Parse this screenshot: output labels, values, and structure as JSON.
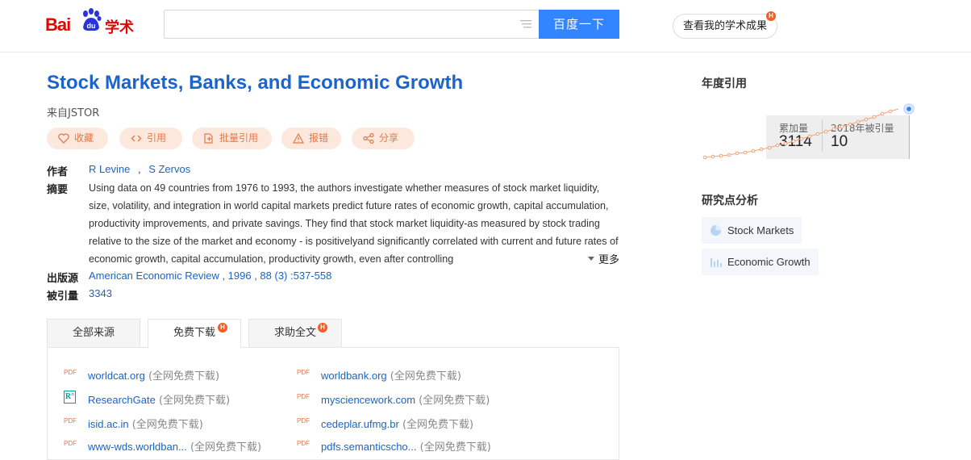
{
  "header": {
    "logo": "Baidu学术",
    "search_placeholder": "",
    "search_button": "百度一下",
    "my_achievements": "查看我的学术成果",
    "badge": "H"
  },
  "paper": {
    "title": "Stock Markets, Banks, and Economic Growth",
    "source": "来自JSTOR",
    "actions": [
      "收藏",
      "引用",
      "批量引用",
      "报错",
      "分享"
    ],
    "authors_label": "作者",
    "authors": [
      "R Levine",
      "S Zervos"
    ],
    "author_separator": ",",
    "abstract_label": "摘要",
    "abstract": "Using data on 49 countries from 1976 to 1993, the authors investigate whether measures of stock market liquidity, size, volatility, and integration in world capital markets predict future rates of economic growth, capital accumulation, productivity improvements, and private savings. They find that stock market liquidity-as measured by stock trading relative to the size of the market and economy - is positivelyand significantly correlated with current and future rates of economic growth, capital accumulation, productivity growth, even after controlling",
    "more": "更多",
    "publication_label": "出版源",
    "publication": "American Economic Review , 1996 , 88 (3) :537-558",
    "cited_label": "被引量",
    "cited_count": "3343"
  },
  "tabs": [
    {
      "label": "全部来源",
      "badge": ""
    },
    {
      "label": "免费下载",
      "badge": "H",
      "active": true
    },
    {
      "label": "求助全文",
      "badge": "H"
    }
  ],
  "downloads": {
    "note": "(全网免费下载)",
    "left": [
      {
        "site": "worldcat.org",
        "icon": "pdf-icon"
      },
      {
        "site": "ResearchGate",
        "icon": "researchgate-icon"
      },
      {
        "site": "isid.ac.in",
        "icon": "pdf-icon"
      },
      {
        "site": "www-wds.worldban...",
        "icon": "pdf-icon"
      }
    ],
    "right": [
      {
        "site": "worldbank.org",
        "icon": "pdf-icon"
      },
      {
        "site": "mysciencework.com",
        "icon": "pdf-icon"
      },
      {
        "site": "cedeplar.ufmg.br",
        "icon": "pdf-icon"
      },
      {
        "site": "pdfs.semanticscho...",
        "icon": "pdf-icon"
      }
    ],
    "pdf_label": "PDF",
    "rg_label": "R°"
  },
  "sidebar": {
    "annual_citations_title": "年度引用",
    "cumulative_label": "累加量",
    "cumulative_value": "3114",
    "year_label": "2018年被引量",
    "year_value": "10",
    "analysis_title": "研究点分析",
    "topics": [
      "Stock Markets",
      "Economic Growth"
    ]
  },
  "colors": {
    "link": "#1c63cb",
    "accent": "#e67748",
    "search_button": "#3385ff",
    "logo_red": "#e10602"
  }
}
